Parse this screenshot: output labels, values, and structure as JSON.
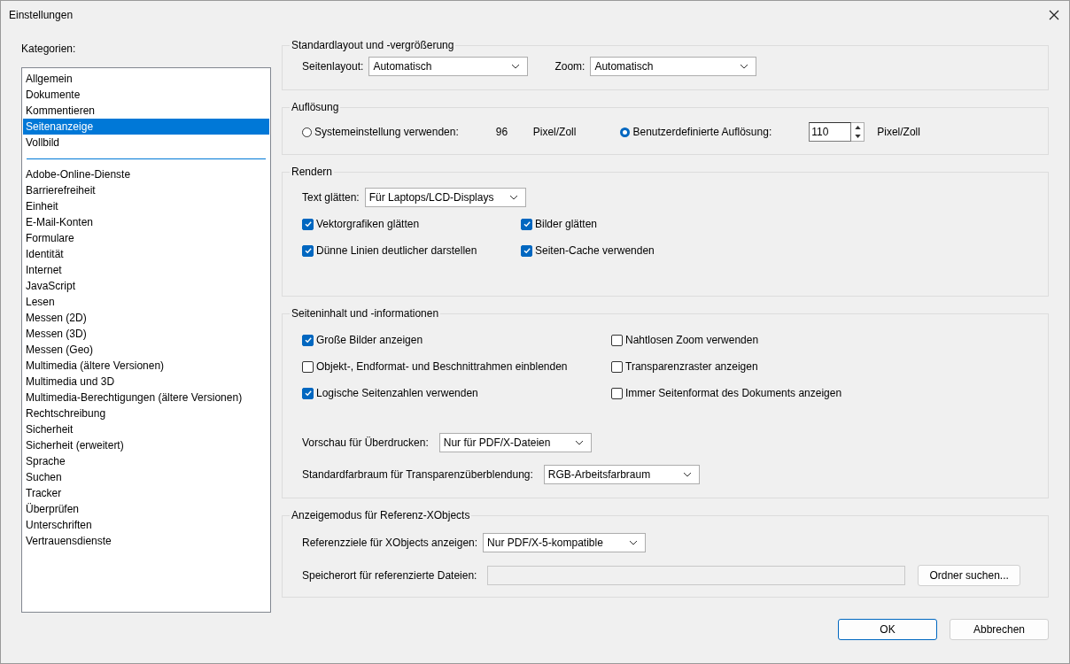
{
  "window": {
    "title": "Einstellungen"
  },
  "categories": {
    "label": "Kategorien:",
    "groups": [
      [
        {
          "label": "Allgemein",
          "selected": false
        },
        {
          "label": "Dokumente",
          "selected": false
        },
        {
          "label": "Kommentieren",
          "selected": false
        },
        {
          "label": "Seitenanzeige",
          "selected": true
        },
        {
          "label": "Vollbild",
          "selected": false
        }
      ],
      [
        {
          "label": "Adobe-Online-Dienste",
          "selected": false
        },
        {
          "label": "Barrierefreiheit",
          "selected": false
        },
        {
          "label": "Einheit",
          "selected": false
        },
        {
          "label": "E-Mail-Konten",
          "selected": false
        },
        {
          "label": "Formulare",
          "selected": false
        },
        {
          "label": "Identität",
          "selected": false
        },
        {
          "label": "Internet",
          "selected": false
        },
        {
          "label": "JavaScript",
          "selected": false
        },
        {
          "label": "Lesen",
          "selected": false
        },
        {
          "label": "Messen (2D)",
          "selected": false
        },
        {
          "label": "Messen (3D)",
          "selected": false
        },
        {
          "label": "Messen (Geo)",
          "selected": false
        },
        {
          "label": "Multimedia (ältere Versionen)",
          "selected": false
        },
        {
          "label": "Multimedia und 3D",
          "selected": false
        },
        {
          "label": "Multimedia-Berechtigungen (ältere Versionen)",
          "selected": false
        },
        {
          "label": "Rechtschreibung",
          "selected": false
        },
        {
          "label": "Sicherheit",
          "selected": false
        },
        {
          "label": "Sicherheit (erweitert)",
          "selected": false
        },
        {
          "label": "Sprache",
          "selected": false
        },
        {
          "label": "Suchen",
          "selected": false
        },
        {
          "label": "Tracker",
          "selected": false
        },
        {
          "label": "Überprüfen",
          "selected": false
        },
        {
          "label": "Unterschriften",
          "selected": false
        },
        {
          "label": "Vertrauensdienste",
          "selected": false
        }
      ]
    ]
  },
  "standard_layout": {
    "title": "Standardlayout und -vergrößerung",
    "page_layout": {
      "label": "Seitenlayout:",
      "value": "Automatisch"
    },
    "zoom": {
      "label": "Zoom:",
      "value": "Automatisch"
    }
  },
  "resolution": {
    "title": "Auflösung",
    "options": [
      {
        "kind": "fixed",
        "label": "Systemeinstellung verwenden:",
        "selected": false,
        "value": "96",
        "unit": "Pixel/Zoll"
      },
      {
        "kind": "spin",
        "label": "Benutzerdefinierte Auflösung:",
        "selected": true,
        "value": "110",
        "unit": "Pixel/Zoll"
      }
    ]
  },
  "rendering": {
    "title": "Rendern",
    "smooth_text": {
      "label": "Text glätten:",
      "value": "Für Laptops/LCD-Displays"
    },
    "checkboxes": [
      {
        "label": "Vektorgrafiken glätten",
        "checked": true
      },
      {
        "label": "Bilder glätten",
        "checked": true
      },
      {
        "label": "Dünne Linien deutlicher darstellen",
        "checked": true
      },
      {
        "label": "Seiten-Cache verwenden",
        "checked": true
      }
    ]
  },
  "page_content": {
    "title": "Seiteninhalt und -informationen",
    "checkboxes": [
      {
        "label": "Große Bilder anzeigen",
        "checked": true
      },
      {
        "label": "Nahtlosen Zoom verwenden",
        "checked": false
      },
      {
        "label": "Objekt-, Endformat- und Beschnittrahmen einblenden",
        "checked": false
      },
      {
        "label": "Transparenzraster anzeigen",
        "checked": false
      },
      {
        "label": "Logische Seitenzahlen verwenden",
        "checked": true
      },
      {
        "label": "Immer Seitenformat des Dokuments anzeigen",
        "checked": false
      }
    ],
    "dropdowns": [
      {
        "label": "Vorschau für Überdrucken:",
        "value": "Nur für PDF/X-Dateien"
      },
      {
        "label": "Standardfarbraum für Transparenzüberblendung:",
        "value": "RGB-Arbeitsfarbraum"
      }
    ]
  },
  "xobjects": {
    "title": "Anzeigemodus für Referenz-XObjects",
    "targets": {
      "label": "Referenzziele für XObjects anzeigen:",
      "value": "Nur PDF/X-5-kompatible"
    },
    "location": {
      "label": "Speicherort für referenzierte Dateien:",
      "button": "Ordner suchen..."
    }
  },
  "buttons": [
    {
      "label": "OK",
      "default": true
    },
    {
      "label": "Abbrechen",
      "default": false
    }
  ]
}
